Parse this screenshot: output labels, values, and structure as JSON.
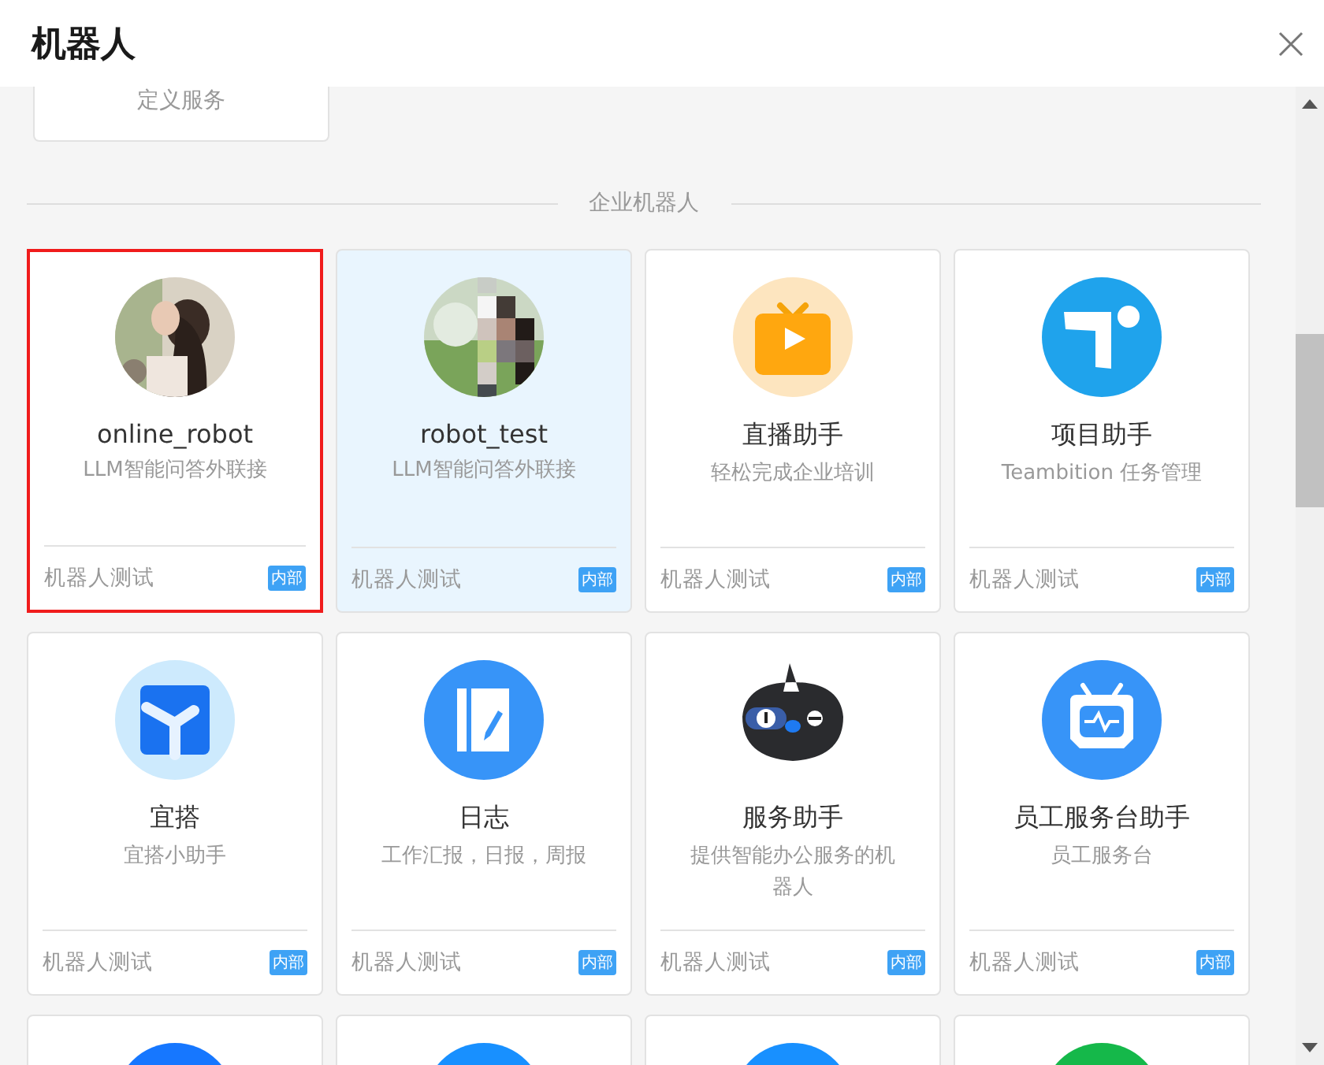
{
  "window": {
    "title": "机器人"
  },
  "top_card": {
    "description": "定义服务"
  },
  "section": {
    "title": "企业机器人"
  },
  "cards": [
    {
      "kind": "picture",
      "name": "online_robot",
      "description": "LLM智能问答外联接",
      "footer": "机器人测试",
      "badge": "内部",
      "selected": true,
      "highlighted": false
    },
    {
      "kind": "picture",
      "name": "robot_test",
      "description": "LLM智能问答外联接",
      "footer": "机器人测试",
      "badge": "内部",
      "selected": false,
      "highlighted": true
    },
    {
      "kind": "tv",
      "name": "直播助手",
      "description": "轻松完成企业培训",
      "footer": "机器人测试",
      "badge": "内部",
      "selected": false,
      "highlighted": false
    },
    {
      "kind": "t-logo",
      "name": "项目助手",
      "description": "Teambition 任务管理",
      "footer": "机器人测试",
      "badge": "内部",
      "selected": false,
      "highlighted": false
    },
    {
      "kind": "y-logo",
      "name": "宜搭",
      "description": "宜搭小助手",
      "footer": "机器人测试",
      "badge": "内部",
      "selected": false,
      "highlighted": false
    },
    {
      "kind": "notebook",
      "name": "日志",
      "description": "工作汇报，日报，周报",
      "footer": "机器人测试",
      "badge": "内部",
      "selected": false,
      "highlighted": false
    },
    {
      "kind": "bird",
      "name": "服务助手",
      "description": "提供智能办公服务的机器人",
      "footer": "机器人测试",
      "badge": "内部",
      "selected": false,
      "highlighted": false
    },
    {
      "kind": "monitor",
      "name": "员工服务台助手",
      "description": "员工服务台",
      "footer": "机器人测试",
      "badge": "内部",
      "selected": false,
      "highlighted": false
    },
    {
      "kind": "partial",
      "color": "#1677ff"
    },
    {
      "kind": "partial",
      "color": "#1890ff"
    },
    {
      "kind": "partial",
      "color": "#1890ff"
    },
    {
      "kind": "partial",
      "color": "#15b84a"
    }
  ]
}
